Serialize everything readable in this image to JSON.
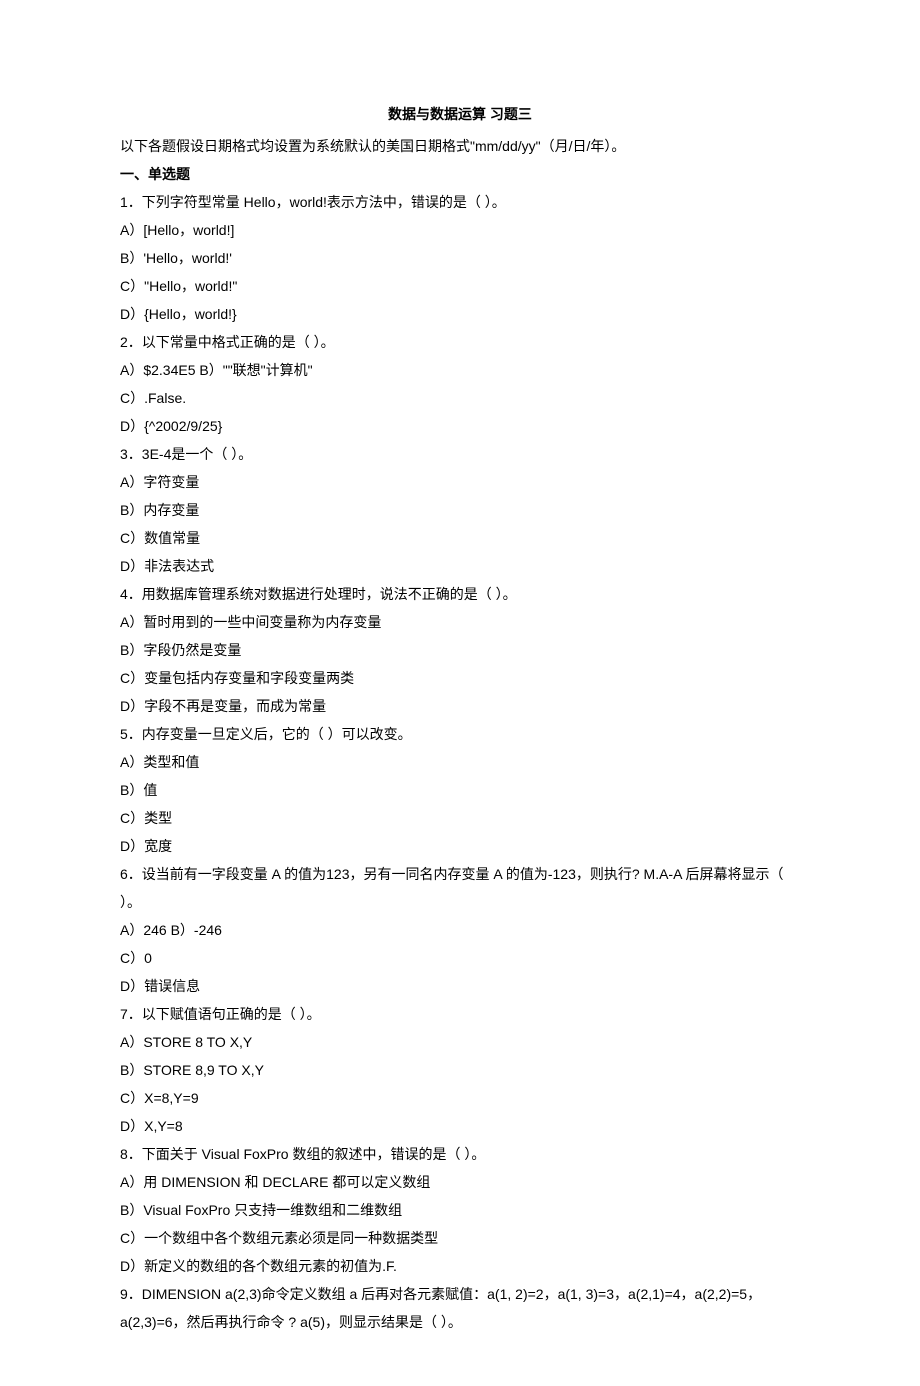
{
  "title": "数据与数据运算  习题三",
  "note": "以下各题假设日期格式均设置为系统默认的美国日期格式\"mm/dd/yy\"（月/日/年）。",
  "section": "一、单选题",
  "questions": [
    {
      "prompt": "1．下列字符型常量 Hello，world!表示方法中，错误的是（  ）。",
      "options": [
        "A）[Hello，world!]",
        "B）'Hello，world!'",
        "C）\"Hello，world!\"",
        "D）{Hello，world!}"
      ]
    },
    {
      "prompt": "2．以下常量中格式正确的是（  ）。",
      "options": [
        "A）$2.34E5 B）\"\"联想\"计算机\"",
        "C）.False.",
        "D）{^2002/9/25}"
      ]
    },
    {
      "prompt": "3．3E-4是一个（  ）。",
      "options": [
        "A）字符变量",
        "B）内存变量",
        "C）数值常量",
        "D）非法表达式"
      ]
    },
    {
      "prompt": "4．用数据库管理系统对数据进行处理时，说法不正确的是（  ）。",
      "options": [
        "A）暂时用到的一些中间变量称为内存变量",
        "B）字段仍然是变量",
        "C）变量包括内存变量和字段变量两类",
        "D）字段不再是变量，而成为常量"
      ]
    },
    {
      "prompt": "5．内存变量一旦定义后，它的（  ）可以改变。",
      "options": [
        "A）类型和值",
        "B）值",
        "C）类型",
        "D）宽度"
      ]
    },
    {
      "prompt": "6．设当前有一字段变量 A 的值为123，另有一同名内存变量 A 的值为-123，则执行? M.A-A 后屏幕将显示（  ）。",
      "options": [
        "A）246 B）-246",
        "C）0",
        "D）错误信息"
      ]
    },
    {
      "prompt": "7．以下赋值语句正确的是（  ）。",
      "options": [
        "A）STORE 8 TO X,Y",
        "B）STORE 8,9 TO X,Y",
        "C）X=8,Y=9",
        "D）X,Y=8"
      ]
    },
    {
      "prompt": "8．下面关于 Visual FoxPro 数组的叙述中，错误的是（  ）。",
      "options": [
        "A）用 DIMENSION 和 DECLARE 都可以定义数组",
        "B）Visual FoxPro 只支持一维数组和二维数组",
        "C）一个数组中各个数组元素必须是同一种数据类型",
        "D）新定义的数组的各个数组元素的初值为.F."
      ]
    },
    {
      "prompt": "9．DIMENSION a(2,3)命令定义数组 a 后再对各元素赋值：a(1, 2)=2，a(1, 3)=3，a(2,1)=4，a(2,2)=5，a(2,3)=6，然后再执行命令  ? a(5)，则显示结果是（  ）。",
      "options": []
    }
  ]
}
